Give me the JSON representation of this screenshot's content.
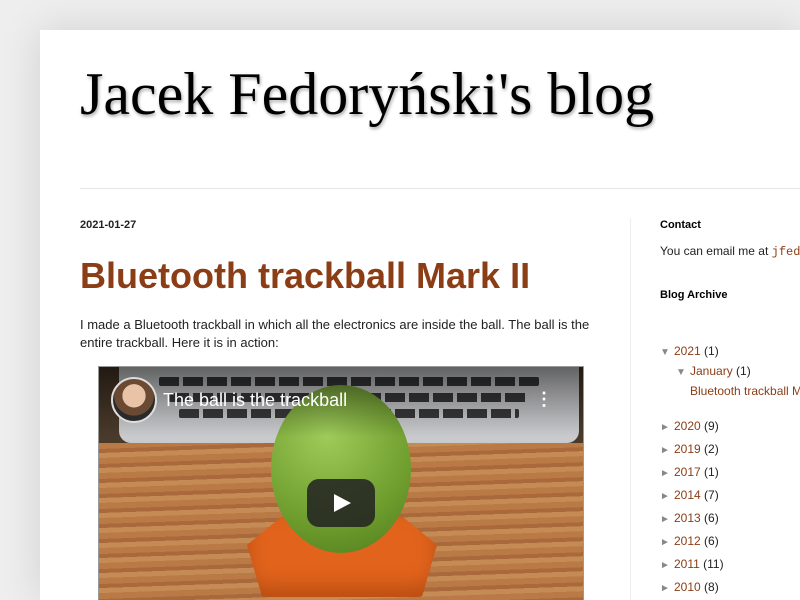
{
  "blog": {
    "title": "Jacek Fedoryński's blog"
  },
  "post": {
    "date": "2021-01-27",
    "title": "Bluetooth trackball Mark II",
    "intro": "I made a Bluetooth trackball in which all the electronics are inside the ball. The ball is the entire trackball. Here it is in action:",
    "video": {
      "title": "The ball is the trackball",
      "menu_glyph": "⋮"
    }
  },
  "sidebar": {
    "contact": {
      "title": "Contact",
      "text": "You can email me at ",
      "email": "jfed"
    },
    "archive": {
      "title": "Blog Archive",
      "expanded_year": {
        "toggle": "▼",
        "label": "2021",
        "count": "(1)"
      },
      "expanded_month": {
        "toggle": "▼",
        "label": "January",
        "count": "(1)"
      },
      "post_link": "Bluetooth trackball M",
      "years": [
        {
          "toggle": "►",
          "label": "2020",
          "count": "(9)"
        },
        {
          "toggle": "►",
          "label": "2019",
          "count": "(2)"
        },
        {
          "toggle": "►",
          "label": "2017",
          "count": "(1)"
        },
        {
          "toggle": "►",
          "label": "2014",
          "count": "(7)"
        },
        {
          "toggle": "►",
          "label": "2013",
          "count": "(6)"
        },
        {
          "toggle": "►",
          "label": "2012",
          "count": "(6)"
        },
        {
          "toggle": "►",
          "label": "2011",
          "count": "(11)"
        },
        {
          "toggle": "►",
          "label": "2010",
          "count": "(8)"
        }
      ]
    }
  },
  "colors": {
    "link": "#8b3d15",
    "post_title": "#8b3d15",
    "background": "#eeeeee"
  }
}
